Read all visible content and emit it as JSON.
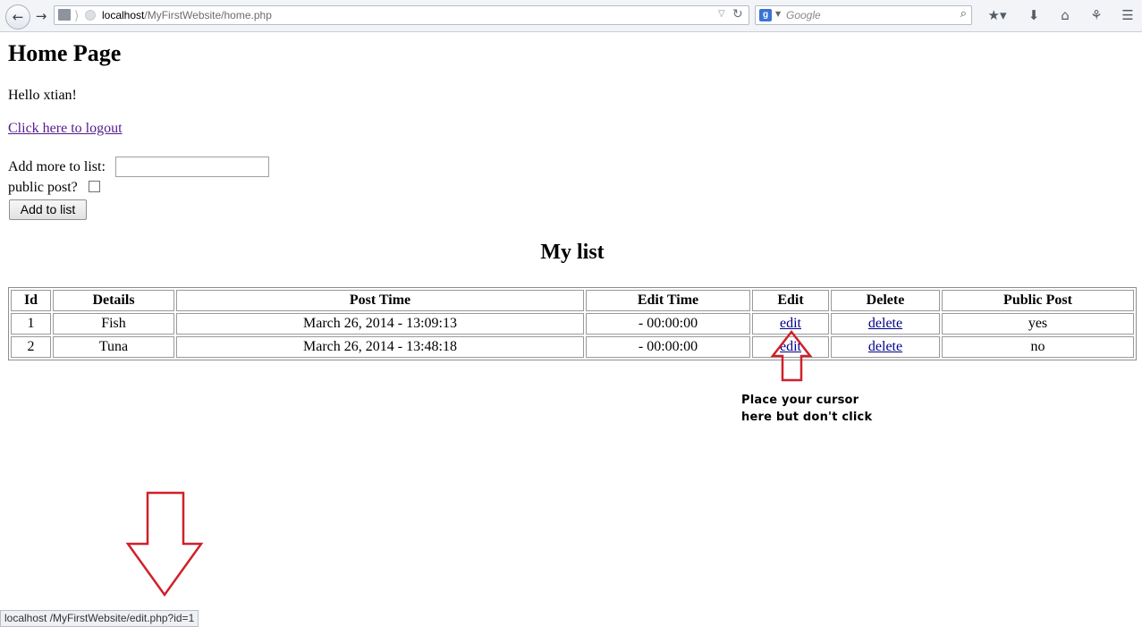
{
  "browser": {
    "url_host": "localhost",
    "url_path": "/MyFirstWebsite/home.php",
    "search_engine_icon": "google-icon",
    "search_placeholder": "Google"
  },
  "page": {
    "title": "Home Page",
    "greeting": "Hello xtian!",
    "logout_link": "Click here to logout",
    "add_label": "Add more to list:",
    "add_input_value": "",
    "public_label": "public post?",
    "public_checked": false,
    "add_button": "Add to list",
    "list_heading": "My list"
  },
  "table": {
    "headers": [
      "Id",
      "Details",
      "Post Time",
      "Edit Time",
      "Edit",
      "Delete",
      "Public Post"
    ],
    "rows": [
      {
        "id": "1",
        "details": "Fish",
        "post_time": "March 26, 2014 - 13:09:13",
        "edit_time": "- 00:00:00",
        "edit": "edit",
        "delete": "delete",
        "public": "yes"
      },
      {
        "id": "2",
        "details": "Tuna",
        "post_time": "March 26, 2014 - 13:48:18",
        "edit_time": "- 00:00:00",
        "edit": "edit",
        "delete": "delete",
        "public": "no"
      }
    ]
  },
  "annotation": {
    "note": "Place your cursor here but don't click",
    "arrow_color": "#d0202a"
  },
  "status": {
    "host": "localhost",
    "path": "/MyFirstWebsite/edit.php?id=1"
  }
}
